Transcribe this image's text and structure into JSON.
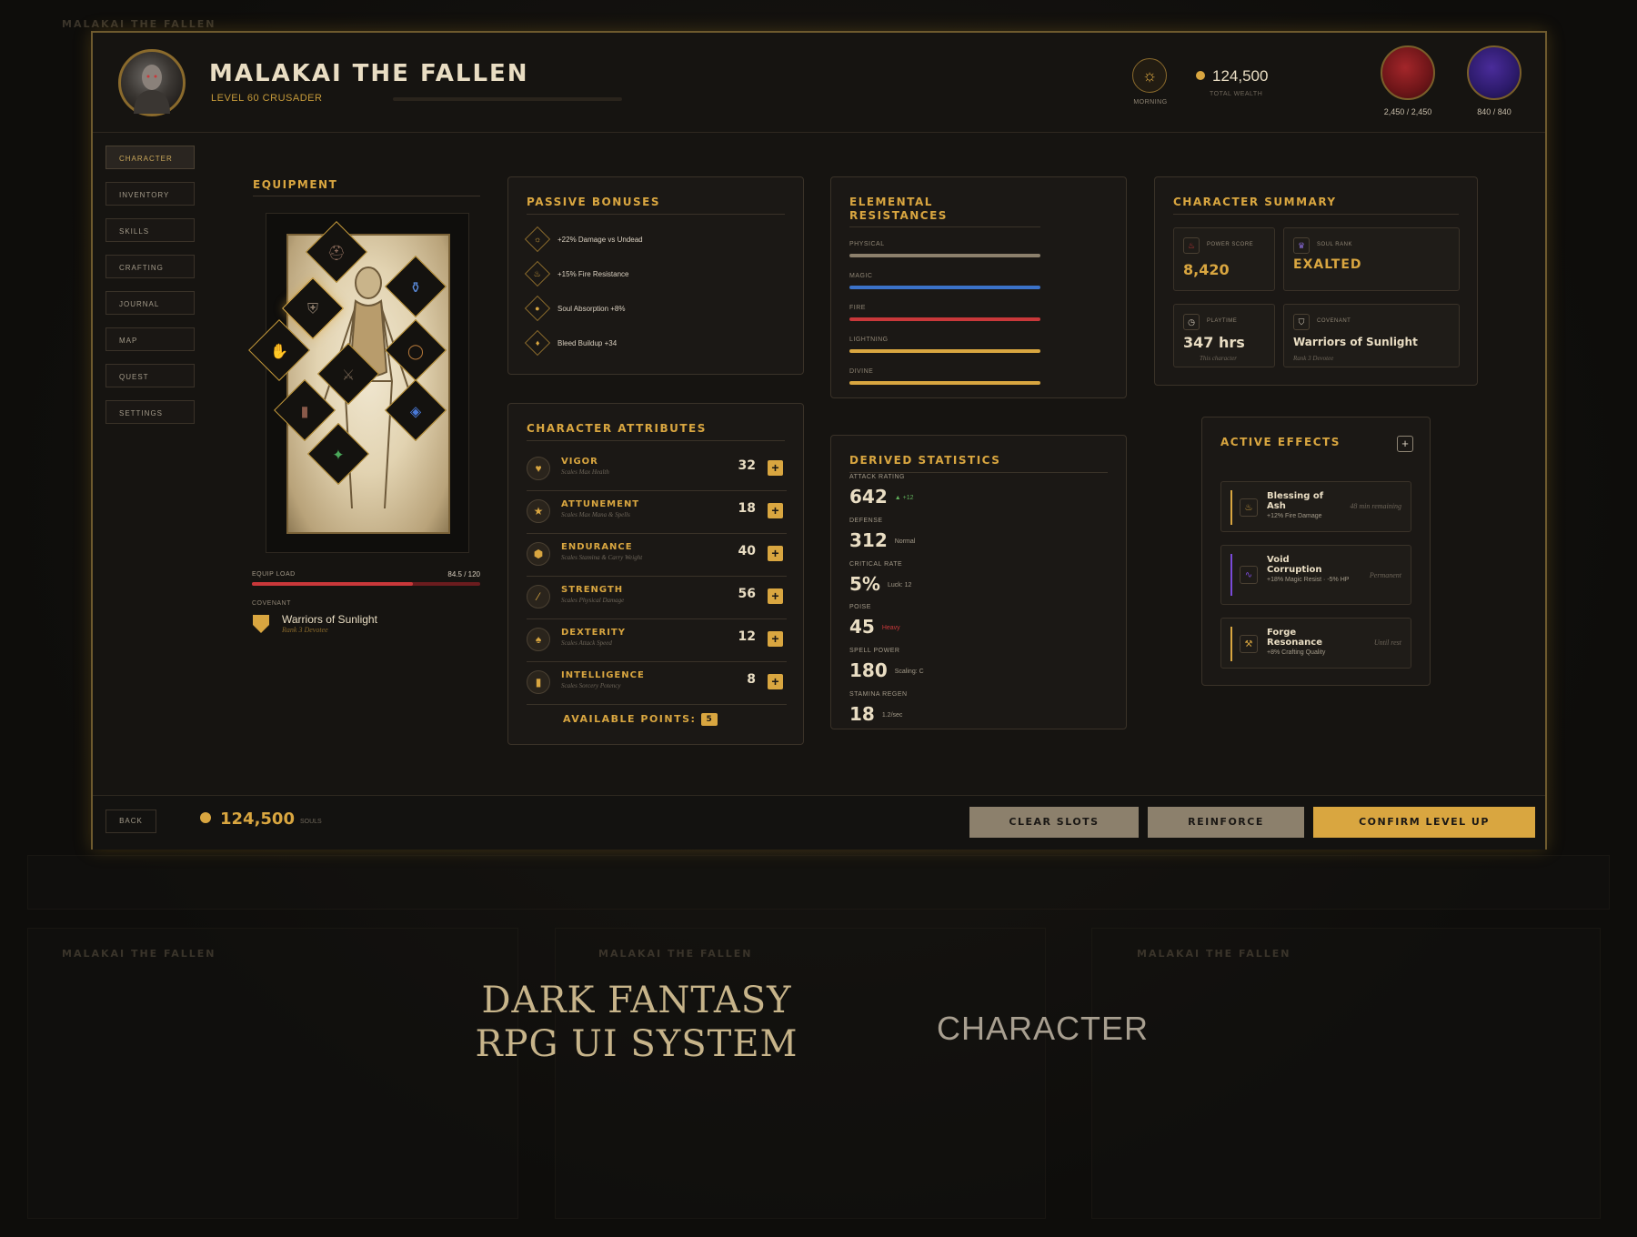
{
  "player": {
    "name": "MALAKAI THE FALLEN",
    "level_class": "LEVEL 60 CRUSADER",
    "time_of_day": "MORNING",
    "wealth": "124,500",
    "wealth_label": "TOTAL WEALTH",
    "health": "2,450 / 2,450",
    "mana": "840 / 840"
  },
  "nav": {
    "items": [
      "CHARACTER",
      "INVENTORY",
      "SKILLS",
      "CRAFTING",
      "JOURNAL",
      "MAP",
      "QUEST",
      "SETTINGS"
    ],
    "active": "CHARACTER"
  },
  "equipment": {
    "title": "EQUIPMENT",
    "load_label": "EQUIP LOAD",
    "load_value": "84.5 / 120",
    "load_fraction": 0.704,
    "covenant_label": "COVENANT",
    "covenant_name": "Warriors of Sunlight",
    "covenant_rank": "Rank 3 Devotee"
  },
  "passive": {
    "title": "PASSIVE BONUSES",
    "items": [
      "+22% Damage vs Undead",
      "+15% Fire Resistance",
      "Soul Absorption +8%",
      "Bleed Buildup +34"
    ]
  },
  "attributes": {
    "title": "CHARACTER ATTRIBUTES",
    "items": [
      {
        "name": "VIGOR",
        "sub": "Scales Max Health",
        "value": "32"
      },
      {
        "name": "ATTUNEMENT",
        "sub": "Scales Max Mana & Spells",
        "value": "18"
      },
      {
        "name": "ENDURANCE",
        "sub": "Scales Stamina & Carry Weight",
        "value": "40"
      },
      {
        "name": "STRENGTH",
        "sub": "Scales Physical Damage",
        "value": "56"
      },
      {
        "name": "DEXTERITY",
        "sub": "Scales Attack Speed",
        "value": "12"
      },
      {
        "name": "INTELLIGENCE",
        "sub": "Scales Sorcery Potency",
        "value": "8"
      }
    ],
    "available_label": "AVAILABLE POINTS:",
    "available_value": "5"
  },
  "resistances": {
    "title_line1": "ELEMENTAL",
    "title_line2": "RESISTANCES",
    "items": [
      {
        "name": "PHYSICAL",
        "color": "#8c806c"
      },
      {
        "name": "MAGIC",
        "color": "#3b72c9"
      },
      {
        "name": "FIRE",
        "color": "#c9383a"
      },
      {
        "name": "LIGHTNING",
        "color": "#d9a640"
      },
      {
        "name": "DIVINE",
        "color": "#d9a640"
      }
    ]
  },
  "derived": {
    "title": "DERIVED STATISTICS",
    "items": [
      {
        "label": "ATTACK RATING",
        "value": "642",
        "note": "▲ +12",
        "note_color": "#5fae5a"
      },
      {
        "label": "DEFENSE",
        "value": "312",
        "note": "Normal",
        "note_color": "#a39a89"
      },
      {
        "label": "CRITICAL RATE",
        "value": "5%",
        "note": "Luck: 12",
        "note_color": "#a39a89"
      },
      {
        "label": "POISE",
        "value": "45",
        "note": "Heavy",
        "note_color": "#c9383a"
      },
      {
        "label": "SPELL POWER",
        "value": "180",
        "note": "Scaling: C",
        "note_color": "#a39a89"
      },
      {
        "label": "STAMINA REGEN",
        "value": "18",
        "note": "1.2/sec",
        "note_color": "#a39a89"
      }
    ]
  },
  "summary": {
    "title": "CHARACTER SUMMARY",
    "power_label": "POWER SCORE",
    "power_value": "8,420",
    "rank_label": "SOUL RANK",
    "rank_value": "EXALTED",
    "playtime_label": "PLAYTIME",
    "playtime_value": "347 hrs",
    "playtime_sub": "This character",
    "covenant_label": "COVENANT",
    "covenant_value": "Warriors of Sunlight",
    "covenant_sub": "Rank 3 Devotee"
  },
  "effects": {
    "title": "ACTIVE EFFECTS",
    "items": [
      {
        "name": "Blessing of Ash",
        "detail": "+12% Fire Damage",
        "duration": "48 min remaining",
        "color": "#d9a640"
      },
      {
        "name": "Void Corruption",
        "detail": "+18% Magic Resist · -5% HP",
        "duration": "Permanent",
        "color": "#7a4ad9"
      },
      {
        "name": "Forge Resonance",
        "detail": "+8% Crafting Quality",
        "duration": "Until rest",
        "color": "#d9a640"
      }
    ]
  },
  "footer": {
    "back": "BACK",
    "souls": "124,500",
    "souls_unit": "SOULS",
    "clear": "CLEAR SLOTS",
    "reinforce": "REINFORCE",
    "confirm": "CONFIRM LEVEL UP"
  },
  "promo": {
    "line1": "DARK FANTASY",
    "line2": "RPG UI SYSTEM",
    "subtitle": "CHARACTER"
  },
  "colors": {
    "accent": "#d9a640",
    "bg": "#161411",
    "panel": "#1b1815",
    "border": "#3a3228"
  }
}
